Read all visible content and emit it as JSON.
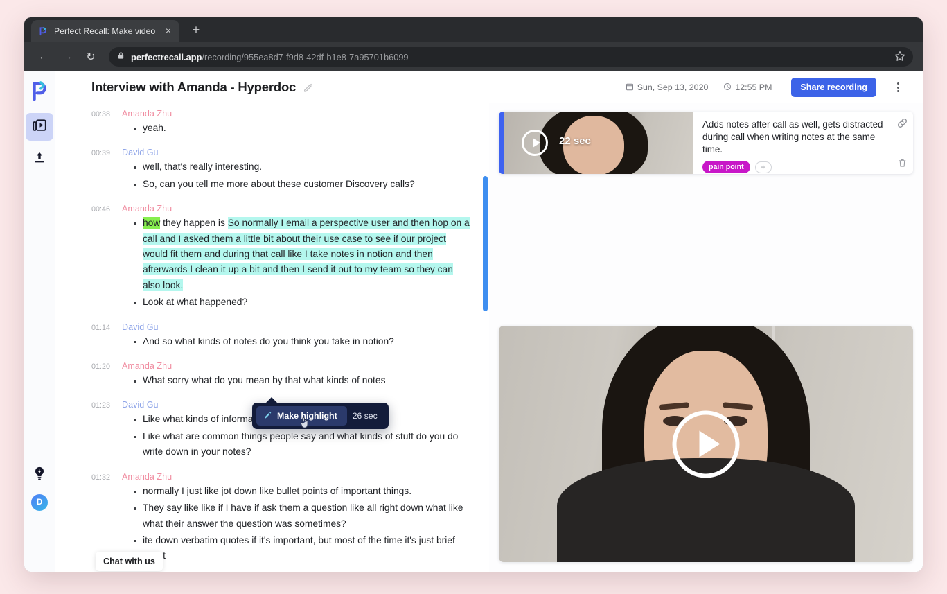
{
  "browser": {
    "tab": {
      "title": "Perfect Recall: Make video high",
      "favicon": "perfect-recall-logo",
      "close_label": "×"
    },
    "new_tab_label": "+",
    "nav": {
      "back": "←",
      "forward": "→",
      "reload": "↻"
    },
    "url": {
      "domain": "perfectrecall.app",
      "path": "/recording/955ea8d7-f9d8-42df-b1e8-7a95701b6099"
    }
  },
  "sidebar": {
    "logo": "perfect-recall-logo",
    "items": [
      {
        "icon": "recordings-icon",
        "label": "Recordings",
        "active": true
      },
      {
        "icon": "upload-icon",
        "label": "Upload",
        "active": false
      }
    ],
    "bottom": [
      {
        "icon": "lightbulb-icon",
        "label": "Tips"
      }
    ],
    "avatar_initial": "D"
  },
  "header": {
    "title": "Interview with Amanda - Hyperdoc",
    "edit_icon": "pencil-icon",
    "date": "Sun, Sep 13, 2020",
    "date_icon": "calendar-icon",
    "time": "12:55 PM",
    "time_icon": "clock-icon",
    "share_label": "Share recording",
    "menu_icon": "kebab-menu-icon"
  },
  "transcript": {
    "segments": [
      {
        "time": "00:38",
        "speaker": "Amanda Zhu",
        "speaker_class": "sp-amanda",
        "lines": [
          {
            "text": "yeah."
          }
        ]
      },
      {
        "time": "00:39",
        "speaker": "David Gu",
        "speaker_class": "sp-david",
        "lines": [
          {
            "text": "well, that's really interesting."
          },
          {
            "text": "So, can you tell me more about these customer Discovery calls?"
          }
        ]
      },
      {
        "time": "00:46",
        "speaker": "Amanda Zhu",
        "speaker_class": "sp-amanda",
        "lines": [
          {
            "green": "how",
            "plain": " they happen is ",
            "cyan": "So normally I email a perspective user and then hop on a call and I asked them a little bit about their use case to see if our project would fit them and during that call like I take notes in notion and then afterwards I clean it up a bit and then I send it out to my team so they can also look."
          },
          {
            "text": "Look at what happened?"
          }
        ]
      },
      {
        "time": "01:14",
        "speaker": "David Gu",
        "speaker_class": "sp-david",
        "lines": [
          {
            "text": "And so what kinds of notes do you think you take in notion?"
          }
        ]
      },
      {
        "time": "01:20",
        "speaker": "Amanda Zhu",
        "speaker_class": "sp-amanda",
        "lines": [
          {
            "text": "What sorry what do you mean by that what kinds of notes"
          }
        ]
      },
      {
        "time": "01:23",
        "speaker": "David Gu",
        "speaker_class": "sp-david",
        "lines": [
          {
            "text": "Like what kinds of information do you write down?"
          },
          {
            "text": "Like what are common things people say and what kinds of stuff do you do write down in your notes?"
          }
        ]
      },
      {
        "time": "01:32",
        "speaker": "Amanda Zhu",
        "speaker_class": "sp-amanda",
        "lines": [
          {
            "text": "normally I just like jot down like bullet points of important things."
          },
          {
            "text": "They say like like if I have if ask them a question like all right down what like what their answer the question was sometimes?"
          },
          {
            "text": "ite down verbatim quotes if it's important, but most of the time it's just brief bullet"
          }
        ]
      }
    ]
  },
  "popover": {
    "button_label": "Make highlight",
    "button_icon": "pencil-icon",
    "duration": "26 sec",
    "cursor": "hand-cursor"
  },
  "chat_widget": {
    "label": "Chat with us"
  },
  "highlight_card": {
    "duration": "22 sec",
    "play_icon": "play-icon",
    "note": "Adds notes after call as well, gets distracted during call when writing notes at the same time.",
    "tag": "pain point",
    "add_tag_label": "+",
    "link_icon": "link-icon",
    "delete_icon": "trash-icon"
  },
  "player": {
    "play_icon": "play-icon"
  },
  "colors": {
    "accent_blue": "#3c63e8",
    "highlight_green": "#86ee4e",
    "highlight_cyan": "#b4f7ee",
    "tag_magenta": "#c817c8",
    "speaker_amanda": "#f08ca0",
    "speaker_david": "#8fa5e8",
    "page_background": "#fbe8e9"
  }
}
